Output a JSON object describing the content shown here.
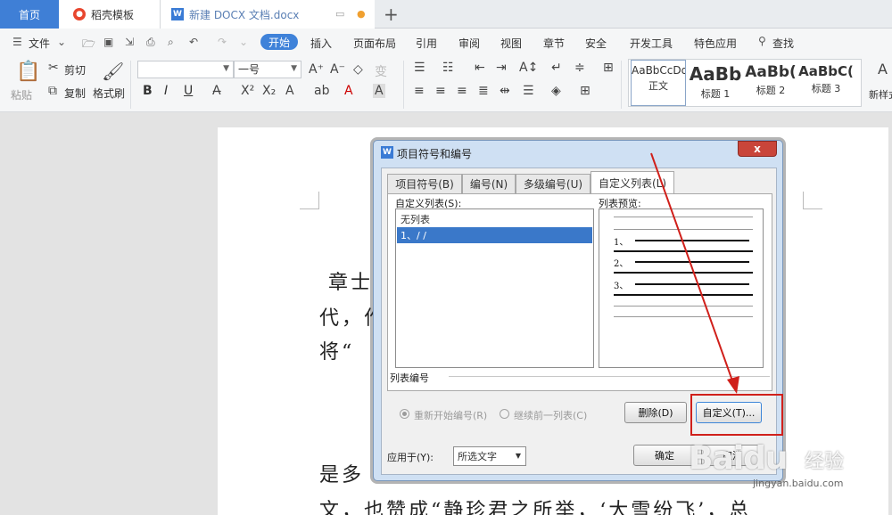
{
  "tabs": {
    "home": "首页",
    "templates": "稻壳模板",
    "document": "新建 DOCX 文档.docx"
  },
  "icons": {
    "template": "daoke-logo-icon",
    "doc": "wps-writer-icon",
    "monitor": "monitor-icon",
    "unsaved": "unsaved-dot-icon",
    "new_tab": "plus-icon",
    "search": "search-icon"
  },
  "menu": {
    "file": "文件",
    "items": [
      "开始",
      "插入",
      "页面布局",
      "引用",
      "审阅",
      "视图",
      "章节",
      "安全",
      "开发工具",
      "特色应用"
    ],
    "search": "查找"
  },
  "ribbon": {
    "paste": "粘贴",
    "cut": "剪切",
    "copy": "复制",
    "format_painter": "格式刷",
    "font_name": "",
    "font_size": "一号",
    "bold": "B",
    "italic": "I",
    "underline": "U",
    "styles": [
      {
        "preview": "AaBbCcDd",
        "name": "正文"
      },
      {
        "preview": "AaBb",
        "name": "标题 1"
      },
      {
        "preview": "AaBb(",
        "name": "标题 2"
      },
      {
        "preview": "AaBbC(",
        "name": "标题 3"
      }
    ],
    "new_style": "新样式"
  },
  "document": {
    "lines": [
      "章士",
      "代，作",
      "将“",
      "是多",
      "文，也赞成“静珍君之所举，‘大雪纷飞’，总"
    ]
  },
  "dialog": {
    "title": "项目符号和编号",
    "close": "x",
    "tabs": [
      "项目符号(B)",
      "编号(N)",
      "多级编号(U)",
      "自定义列表(L)"
    ],
    "custom_list_label": "自定义列表(S):",
    "preview_label": "列表预览:",
    "list_items": [
      "无列表",
      "1、/ /"
    ],
    "preview_numbers": [
      "1、",
      "2、",
      "3、"
    ],
    "numbering_label": "列表编号",
    "restart_label": "重新开始编号(R)",
    "continue_label": "继续前一列表(C)",
    "delete_button": "删除(D)",
    "custom_button": "自定义(T)...",
    "apply_label": "应用于(Y):",
    "apply_value": "所选文字",
    "ok_button": "确定",
    "cancel_button": "取消"
  },
  "watermark": {
    "logo": "Baidu",
    "jingyan": "经验",
    "url": "jingyan.baidu.com"
  },
  "colors": {
    "accent": "#3f82d9",
    "annotation_red": "#d0201b"
  }
}
